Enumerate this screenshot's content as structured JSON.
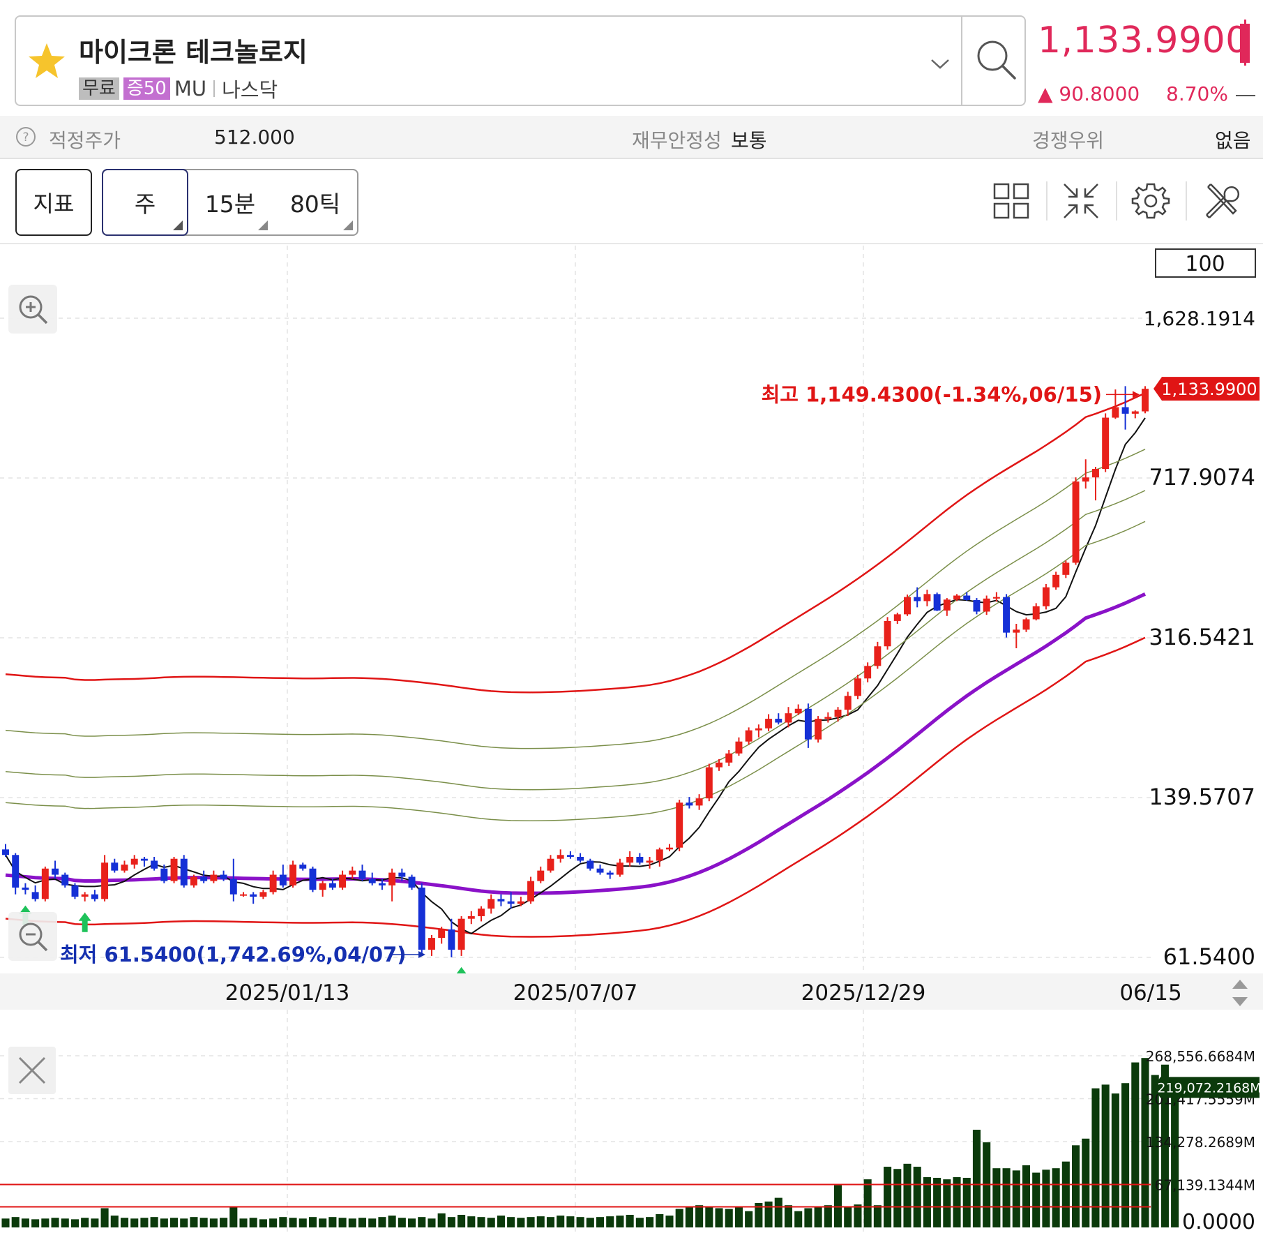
{
  "header": {
    "stock_name": "마이크론 테크놀로지",
    "tag_free": "무료",
    "tag_margin": "증50",
    "ticker": "MU",
    "exchange": "나스닥"
  },
  "quote": {
    "price": "1,133.9900",
    "change": "▲ 90.8000",
    "change_pct": "8.70%",
    "color_up": "#e0285a"
  },
  "info": {
    "fair_price_label": "적정주가",
    "fair_price_value": "512.000",
    "stability_label": "재무안정성",
    "stability_value": "보통",
    "competitive_label": "경쟁우위",
    "competitive_value": "없음"
  },
  "toolbar": {
    "indicator_label": "지표",
    "periods": [
      "주",
      "15분",
      "80틱"
    ],
    "icons": [
      "layout-grid-icon",
      "collapse-icon",
      "settings-gear-icon",
      "tools-icon"
    ]
  },
  "chart_data": {
    "type": "candlestick",
    "scale": "log",
    "scale_box": "100",
    "y_ticks": [
      "1,628.1914",
      "717.9074",
      "316.5421",
      "139.5707",
      "61.5400"
    ],
    "y_tick_values": [
      1628.1914,
      717.9074,
      316.5421,
      139.5707,
      61.54
    ],
    "x_ticks": [
      "2025/01/13",
      "2025/07/07",
      "2025/12/29",
      "06/15"
    ],
    "current_price_label": "1,133.9900",
    "high_annotation": "최고 1,149.4300(-1.34%,06/15)",
    "low_annotation": "최저 61.5400(1,742.69%,04/07)",
    "colors": {
      "up": "#e8211b",
      "down": "#1530d6",
      "ma_purple": "#8a12c8",
      "envelope": "#e01515",
      "band": "#7b8f4a",
      "ma_black": "#111111"
    },
    "candles": [
      [
        107,
        110,
        103,
        104
      ],
      [
        104,
        105,
        85,
        88
      ],
      [
        88,
        90,
        85,
        87
      ],
      [
        86,
        89,
        82,
        83
      ],
      [
        83,
        98,
        82,
        97
      ],
      [
        97,
        101,
        92,
        94
      ],
      [
        94,
        95,
        88,
        89
      ],
      [
        89,
        90,
        83,
        84
      ],
      [
        84,
        86,
        82,
        85
      ],
      [
        85,
        87,
        82,
        83
      ],
      [
        83,
        104,
        82,
        100
      ],
      [
        100,
        102,
        95,
        96
      ],
      [
        96,
        101,
        95,
        99
      ],
      [
        99,
        104,
        97,
        102
      ],
      [
        102,
        103,
        98,
        101
      ],
      [
        101,
        103,
        96,
        97
      ],
      [
        97,
        99,
        90,
        91
      ],
      [
        91,
        103,
        90,
        102
      ],
      [
        102,
        104,
        88,
        89
      ],
      [
        89,
        94,
        88,
        93
      ],
      [
        93,
        96,
        90,
        91
      ],
      [
        91,
        96,
        90,
        94
      ],
      [
        94,
        96,
        91,
        92
      ],
      [
        92,
        102,
        82,
        85
      ],
      [
        85,
        86,
        84,
        85
      ],
      [
        85,
        86,
        81,
        84
      ],
      [
        84,
        87,
        83,
        86
      ],
      [
        86,
        96,
        85,
        94
      ],
      [
        94,
        99,
        88,
        89
      ],
      [
        89,
        101,
        88,
        99
      ],
      [
        99,
        100,
        96,
        97
      ],
      [
        97,
        98,
        86,
        87
      ],
      [
        87,
        91,
        84,
        90
      ],
      [
        90,
        92,
        87,
        88
      ],
      [
        88,
        96,
        87,
        94
      ],
      [
        94,
        98,
        92,
        96
      ],
      [
        96,
        99,
        91,
        92
      ],
      [
        92,
        95,
        89,
        90
      ],
      [
        90,
        92,
        87,
        89
      ],
      [
        89,
        97,
        82,
        95
      ],
      [
        95,
        97,
        91,
        93
      ],
      [
        93,
        94,
        87,
        88
      ],
      [
        88,
        90,
        62,
        64
      ],
      [
        64,
        69,
        62,
        68
      ],
      [
        68,
        72,
        66,
        71
      ],
      [
        71,
        75,
        61.54,
        64
      ],
      [
        64,
        76,
        62,
        75
      ],
      [
        75,
        78,
        73,
        76
      ],
      [
        76,
        80,
        74,
        79
      ],
      [
        79,
        85,
        77,
        83
      ],
      [
        83,
        85,
        80,
        82
      ],
      [
        82,
        86,
        79,
        81
      ],
      [
        81,
        84,
        80,
        82
      ],
      [
        82,
        93,
        81,
        91
      ],
      [
        91,
        98,
        90,
        96
      ],
      [
        96,
        104,
        95,
        102
      ],
      [
        102,
        107,
        100,
        104
      ],
      [
        104,
        106,
        102,
        103
      ],
      [
        103,
        105,
        100,
        101
      ],
      [
        101,
        102,
        96,
        97
      ],
      [
        97,
        99,
        94,
        95
      ],
      [
        95,
        96,
        92,
        94
      ],
      [
        94,
        102,
        93,
        100
      ],
      [
        100,
        106,
        98,
        103
      ],
      [
        103,
        105,
        99,
        100
      ],
      [
        100,
        103,
        97,
        101
      ],
      [
        101,
        108,
        98,
        107
      ],
      [
        107,
        110,
        106,
        108
      ],
      [
        108,
        138,
        106,
        136
      ],
      [
        136,
        140,
        132,
        134
      ],
      [
        134,
        142,
        131,
        139
      ],
      [
        139,
        166,
        137,
        163
      ],
      [
        163,
        170,
        160,
        167
      ],
      [
        167,
        178,
        164,
        175
      ],
      [
        175,
        190,
        173,
        186
      ],
      [
        186,
        200,
        183,
        197
      ],
      [
        197,
        203,
        190,
        199
      ],
      [
        199,
        214,
        196,
        209
      ],
      [
        209,
        215,
        203,
        205
      ],
      [
        205,
        222,
        200,
        215
      ],
      [
        215,
        225,
        213,
        220
      ],
      [
        220,
        226,
        180,
        188
      ],
      [
        188,
        212,
        185,
        209
      ],
      [
        209,
        216,
        205,
        211
      ],
      [
        211,
        222,
        206,
        219
      ],
      [
        219,
        240,
        212,
        235
      ],
      [
        235,
        262,
        231,
        257
      ],
      [
        257,
        279,
        252,
        274
      ],
      [
        274,
        310,
        270,
        303
      ],
      [
        303,
        352,
        298,
        345
      ],
      [
        345,
        360,
        340,
        357
      ],
      [
        357,
        395,
        354,
        390
      ],
      [
        390,
        410,
        370,
        382
      ],
      [
        382,
        405,
        372,
        396
      ],
      [
        396,
        399,
        363,
        364
      ],
      [
        364,
        388,
        354,
        385
      ],
      [
        385,
        396,
        382,
        393
      ],
      [
        393,
        400,
        383,
        384
      ],
      [
        384,
        388,
        357,
        362
      ],
      [
        362,
        393,
        356,
        387
      ],
      [
        387,
        400,
        381,
        390
      ],
      [
        390,
        396,
        317,
        325
      ],
      [
        325,
        340,
        300,
        330
      ],
      [
        330,
        351,
        326,
        348
      ],
      [
        348,
        378,
        346,
        372
      ],
      [
        372,
        417,
        366,
        410
      ],
      [
        410,
        444,
        405,
        437
      ],
      [
        437,
        470,
        430,
        465
      ],
      [
        465,
        720,
        460,
        705
      ],
      [
        705,
        790,
        680,
        720
      ],
      [
        720,
        760,
        640,
        752
      ],
      [
        752,
        1000,
        740,
        978
      ],
      [
        978,
        1130,
        972,
        1032
      ],
      [
        1032,
        1149.43,
        920,
        998
      ],
      [
        998,
        1015,
        975,
        1010
      ],
      [
        1010,
        1149.43,
        1000,
        1133.99
      ]
    ],
    "volume": {
      "y_ticks": [
        "268,556.6684M",
        "201,417.5559M",
        "134,278.2689M",
        "67,139.1344M",
        "0.0000"
      ],
      "y_tick_values": [
        268556.6684,
        201417.5559,
        134278.2689,
        67139.1344,
        0
      ],
      "current_label": "219,072.2168M",
      "color": "#0b3a0b",
      "values": [
        12,
        14,
        12,
        11,
        12,
        13,
        12,
        11,
        13,
        12,
        26,
        16,
        13,
        12,
        13,
        14,
        12,
        13,
        12,
        14,
        13,
        12,
        13,
        27,
        12,
        13,
        11,
        12,
        14,
        13,
        12,
        14,
        12,
        14,
        13,
        12,
        13,
        12,
        14,
        16,
        13,
        12,
        14,
        12,
        19,
        14,
        17,
        15,
        14,
        13,
        16,
        14,
        13,
        14,
        15,
        14,
        16,
        15,
        14,
        13,
        14,
        15,
        16,
        17,
        13,
        14,
        18,
        16,
        25,
        28,
        30,
        27,
        26,
        25,
        27,
        22,
        33,
        35,
        40,
        30,
        22,
        26,
        28,
        30,
        57,
        28,
        31,
        65,
        30,
        82,
        79,
        86,
        82,
        68,
        67,
        65,
        68,
        67,
        132,
        115,
        80,
        80,
        77,
        84,
        74,
        78,
        80,
        89,
        111,
        120,
        188,
        193,
        181,
        195,
        223,
        229,
        206,
        220,
        180
      ]
    }
  }
}
